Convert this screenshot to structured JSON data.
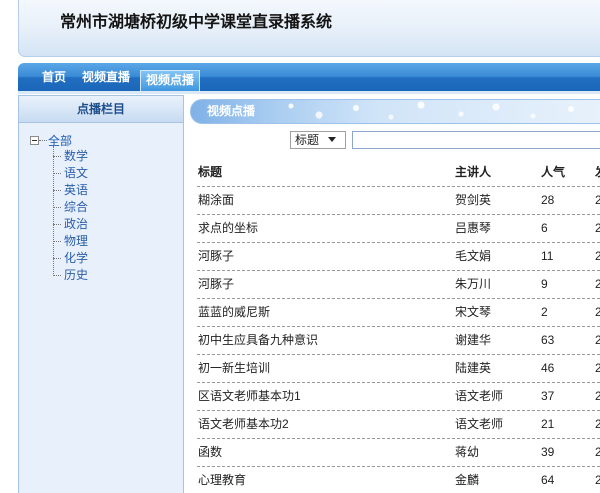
{
  "header": {
    "title": "常州市湖塘桥初级中学课堂直录播系统"
  },
  "nav": {
    "items": [
      {
        "label": "首页",
        "active": false
      },
      {
        "label": "视频直播",
        "active": false
      },
      {
        "label": "视频点播",
        "active": true
      }
    ]
  },
  "sidebar": {
    "title": "点播栏目",
    "tree": {
      "root": {
        "label": "全部",
        "expanded": true,
        "icon": "collapse-minus-icon"
      },
      "children": [
        {
          "label": "数学"
        },
        {
          "label": "语文"
        },
        {
          "label": "英语"
        },
        {
          "label": "综合"
        },
        {
          "label": "政治"
        },
        {
          "label": "物理"
        },
        {
          "label": "化学"
        },
        {
          "label": "历史"
        }
      ]
    }
  },
  "main": {
    "tab_title": "视频点播",
    "search": {
      "field": {
        "selected": "标题",
        "icon": "chevron-down-icon"
      },
      "keyword": {
        "value": ""
      }
    },
    "table": {
      "columns": {
        "title": "标题",
        "speaker": "主讲人",
        "views": "人气",
        "date": "发"
      },
      "rows": [
        {
          "title": "糊涂面",
          "speaker": "贺剑英",
          "views": 28,
          "date": "2"
        },
        {
          "title": "求点的坐标",
          "speaker": "吕惠琴",
          "views": 6,
          "date": "2"
        },
        {
          "title": "河豚子",
          "speaker": "毛文娟",
          "views": 11,
          "date": "2"
        },
        {
          "title": "河豚子",
          "speaker": "朱万川",
          "views": 9,
          "date": "2"
        },
        {
          "title": "蓝蓝的威尼斯",
          "speaker": "宋文琴",
          "views": 2,
          "date": "2"
        },
        {
          "title": "初中生应具备九种意识",
          "speaker": "谢建华",
          "views": 63,
          "date": "2"
        },
        {
          "title": "初一新生培训",
          "speaker": "陆建英",
          "views": 46,
          "date": "2"
        },
        {
          "title": "区语文老师基本功1",
          "speaker": "语文老师",
          "views": 37,
          "date": "2"
        },
        {
          "title": "语文老师基本功2",
          "speaker": "语文老师",
          "views": 21,
          "date": "2"
        },
        {
          "title": "函数",
          "speaker": "蒋幼",
          "views": 39,
          "date": "2"
        },
        {
          "title": "心理教育",
          "speaker": "金麟",
          "views": 64,
          "date": "2"
        }
      ]
    }
  },
  "colors": {
    "nav_blue": "#2d82d2",
    "header_bg": "#e6eff9",
    "sidebar_bg": "#e8f1fb",
    "link_blue": "#2a5cab",
    "text": "#222222",
    "row_divider": "#9a9a9a"
  }
}
